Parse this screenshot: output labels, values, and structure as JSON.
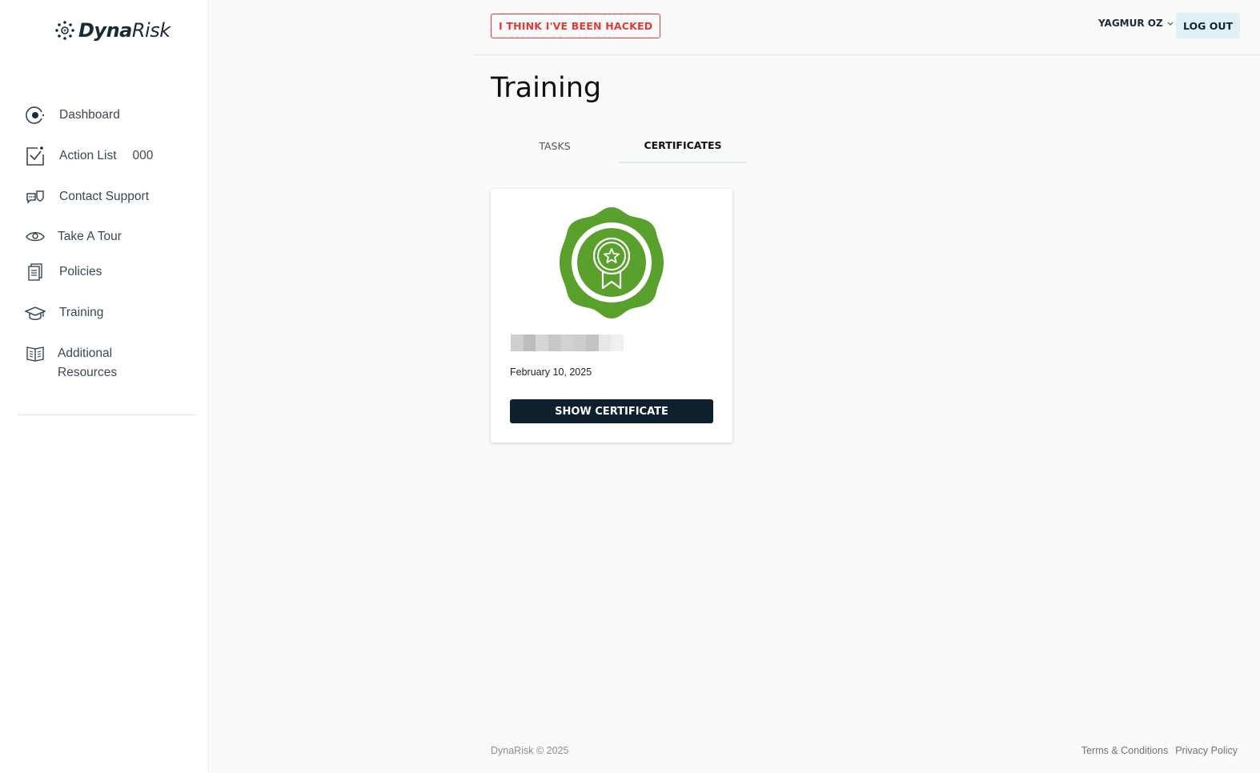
{
  "brand": {
    "name_bold": "Dyna",
    "name_light": "Risk",
    "accent": "#2e7d32"
  },
  "sidebar": {
    "items": [
      {
        "label": "Dashboard",
        "icon": "dashboard-icon"
      },
      {
        "label": "Action List",
        "count": "000",
        "icon": "checklist-icon"
      },
      {
        "label": "Contact Support",
        "icon": "support-chat-icon"
      },
      {
        "label": "Take A Tour",
        "icon": "eye-icon"
      },
      {
        "label": "Policies",
        "icon": "document-icon"
      },
      {
        "label": "Training",
        "icon": "graduation-cap-icon"
      },
      {
        "label": "Additional Resources",
        "label_line1": "Additional",
        "label_line2": "Resources",
        "icon": "book-icon"
      }
    ]
  },
  "header": {
    "hacked_label": "I THINK I'VE BEEN HACKED",
    "user_name": "YAGMUR OZ",
    "logout_label": "LOG OUT"
  },
  "main": {
    "title": "Training",
    "tabs": [
      {
        "label": "TASKS",
        "active": false
      },
      {
        "label": "CERTIFICATES",
        "active": true
      }
    ],
    "certificate": {
      "date": "February 10, 2025",
      "button_label": "SHOW CERTIFICATE",
      "badge_color": "#5aa02c"
    }
  },
  "footer": {
    "copyright": "DynaRisk © 2025",
    "links": [
      "Terms & Conditions",
      "Privacy Policy"
    ]
  },
  "colors": {
    "danger": "#e53935",
    "dark_button": "#0e1f2e",
    "logout_bg": "#e1f0f6"
  }
}
